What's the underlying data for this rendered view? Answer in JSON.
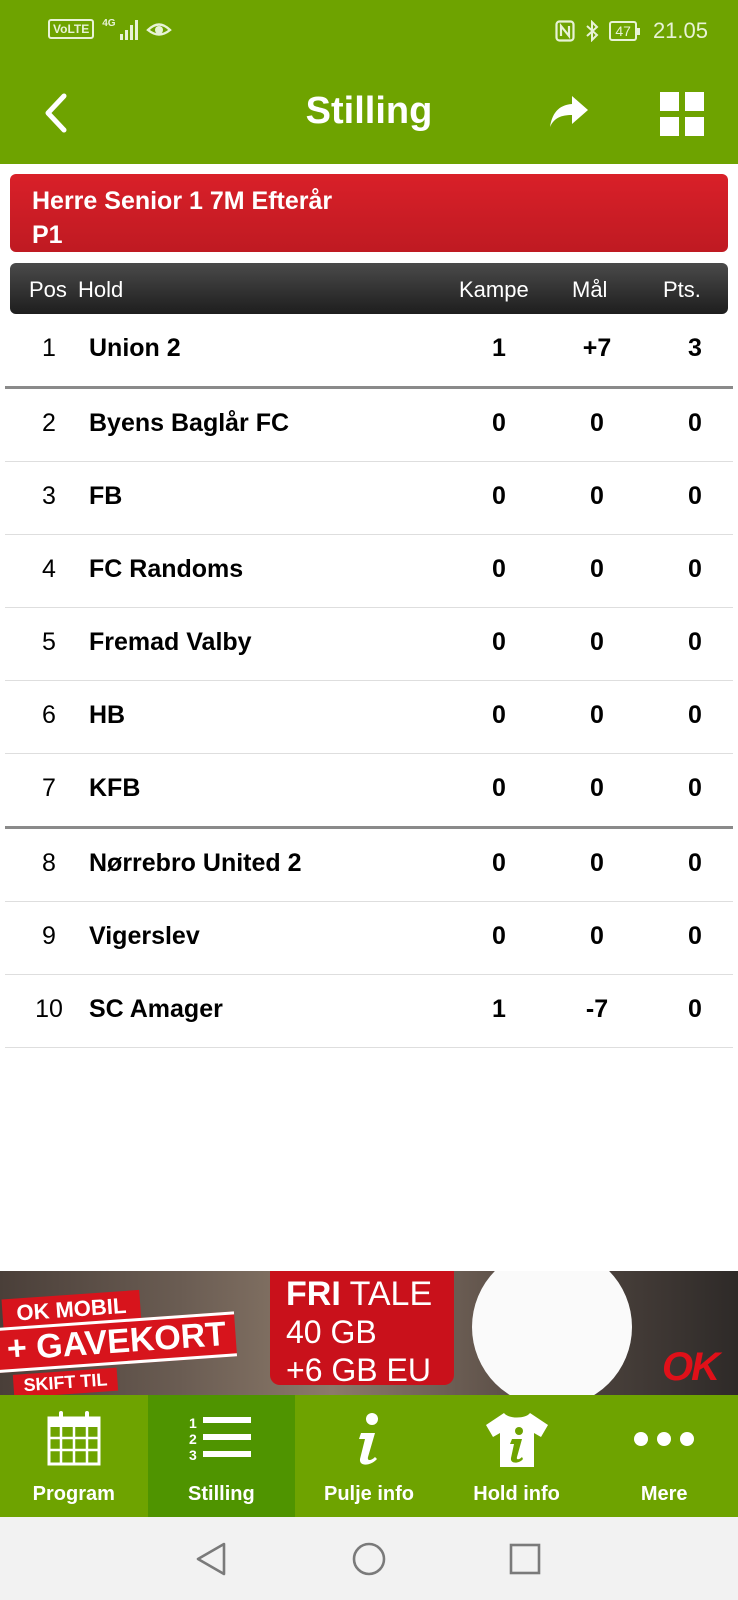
{
  "status_bar": {
    "volte": "VoLTE",
    "network": "4G",
    "battery": "47",
    "time": "21.05"
  },
  "app_bar": {
    "title": "Stilling",
    "icons": [
      "back-arrow-icon",
      "share-icon",
      "grid-menu-icon"
    ]
  },
  "pool": {
    "line1": "Herre Senior 1 7M Efterår",
    "line2": "P1"
  },
  "table": {
    "headers": {
      "pos": "Pos",
      "team": "Hold",
      "matches": "Kampe",
      "goals": "Mål",
      "points": "Pts."
    },
    "rows": [
      {
        "pos": "1",
        "team": "Union 2",
        "matches": "1",
        "goals": "+7",
        "points": "3"
      },
      {
        "pos": "2",
        "team": "Byens Baglår FC",
        "matches": "0",
        "goals": "0",
        "points": "0"
      },
      {
        "pos": "3",
        "team": "FB",
        "matches": "0",
        "goals": "0",
        "points": "0"
      },
      {
        "pos": "4",
        "team": "FC Randoms",
        "matches": "0",
        "goals": "0",
        "points": "0"
      },
      {
        "pos": "5",
        "team": "Fremad Valby",
        "matches": "0",
        "goals": "0",
        "points": "0"
      },
      {
        "pos": "6",
        "team": "HB",
        "matches": "0",
        "goals": "0",
        "points": "0"
      },
      {
        "pos": "7",
        "team": "KFB",
        "matches": "0",
        "goals": "0",
        "points": "0"
      },
      {
        "pos": "8",
        "team": "Nørrebro United 2",
        "matches": "0",
        "goals": "0",
        "points": "0"
      },
      {
        "pos": "9",
        "team": "Vigerslev",
        "matches": "0",
        "goals": "0",
        "points": "0"
      },
      {
        "pos": "10",
        "team": "SC Amager",
        "matches": "1",
        "goals": "-7",
        "points": "0"
      }
    ]
  },
  "ad": {
    "ribbon1": "OK MOBIL",
    "ribbon2": "+ GAVEKORT",
    "ribbon3": "SKIFT TIL",
    "line1_bold": "FRI",
    "line1_rest": " TALE",
    "line2": "40 GB",
    "line3": "+6 GB EU",
    "logo": "OK"
  },
  "bottom_nav": {
    "tabs": [
      {
        "label": "Program",
        "icon": "calendar-icon",
        "active": false
      },
      {
        "label": "Stilling",
        "icon": "ranked-list-icon",
        "active": true
      },
      {
        "label": "Pulje info",
        "icon": "info-icon",
        "active": false
      },
      {
        "label": "Hold info",
        "icon": "shirt-info-icon",
        "active": false
      },
      {
        "label": "Mere",
        "icon": "more-dots-icon",
        "active": false
      }
    ]
  },
  "colors": {
    "brand_green": "#6ea300",
    "active_tab": "#4f9400",
    "pool_red": "#d92029",
    "header_dark": "#2a2a2a"
  }
}
